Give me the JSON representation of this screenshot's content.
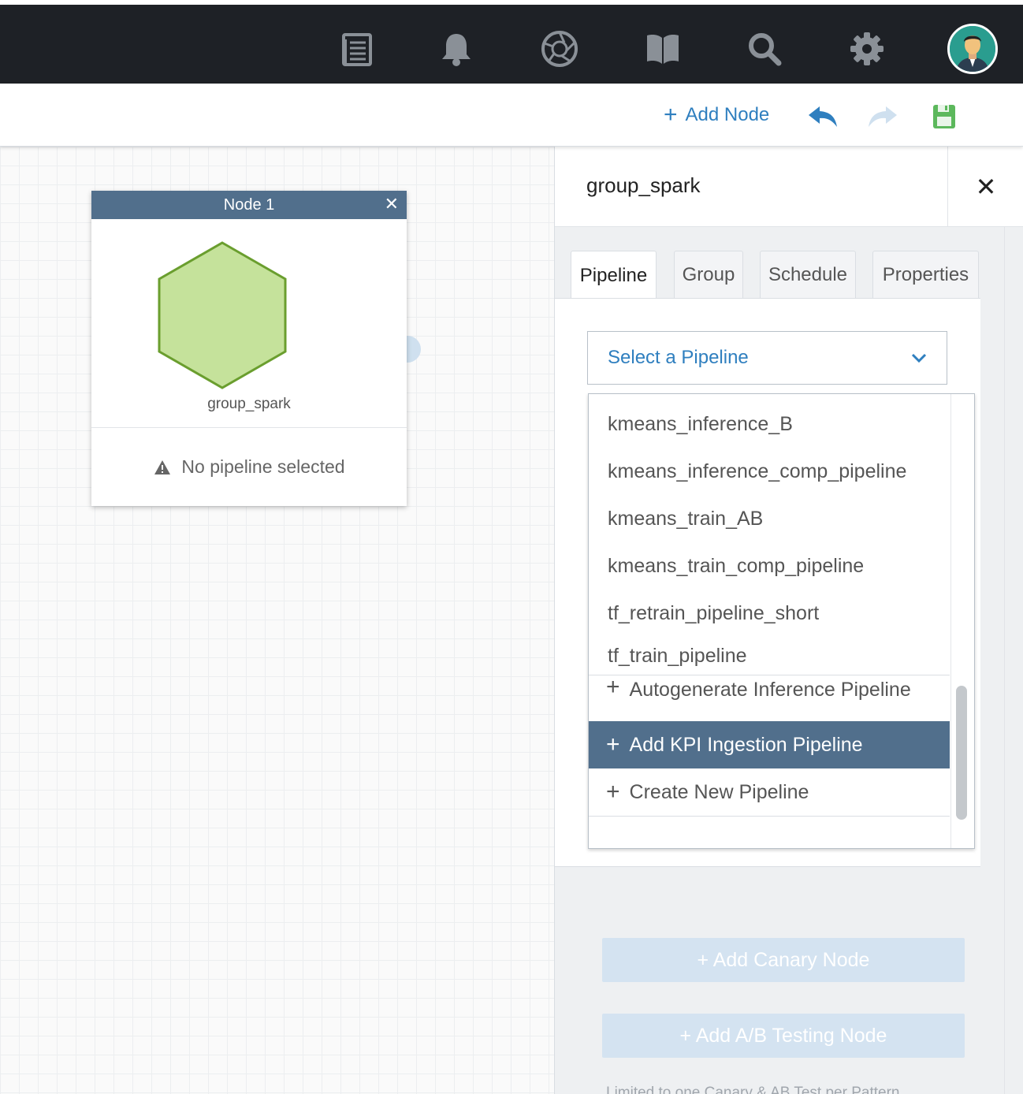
{
  "topnav": {
    "icons": [
      "document-icon",
      "bell-icon",
      "aperture-icon",
      "book-icon",
      "search-icon",
      "gear-icon"
    ],
    "avatar": "user-avatar"
  },
  "toolbar": {
    "add_node_label": "Add Node",
    "undo_icon": "undo-icon",
    "redo_icon": "redo-icon",
    "save_icon": "save-icon"
  },
  "node": {
    "header": "Node 1",
    "close_glyph": "✕",
    "name": "group_spark",
    "status": "No pipeline selected",
    "shape_color": "#c5e29b",
    "shape_stroke": "#6a9e2e"
  },
  "panel": {
    "title": "group_spark",
    "close_glyph": "✕",
    "tabs": [
      {
        "label": "Pipeline"
      },
      {
        "label": "Group"
      },
      {
        "label": "Schedule"
      },
      {
        "label": "Properties"
      }
    ],
    "select_placeholder": "Select a Pipeline",
    "pipelines": [
      "kmeans_inference_B",
      "kmeans_inference_comp_pipeline",
      "kmeans_train_AB",
      "kmeans_train_comp_pipeline",
      "tf_retrain_pipeline_short",
      "tf_train_pipeline"
    ],
    "actions": {
      "autogenerate": "Autogenerate Inference Pipeline",
      "add_kpi": "Add KPI Ingestion Pipeline",
      "create_new": "Create New Pipeline"
    },
    "add_canary_label": "+ Add Canary Node",
    "add_ab_label": "+ Add A/B Testing Node",
    "limit_note": "Limited to one Canary & AB Test per Pattern"
  },
  "colors": {
    "topbar": "#1e2126",
    "accent": "#2f7fbf",
    "header_slate": "#516f8c",
    "save_green": "#5cb85c"
  }
}
